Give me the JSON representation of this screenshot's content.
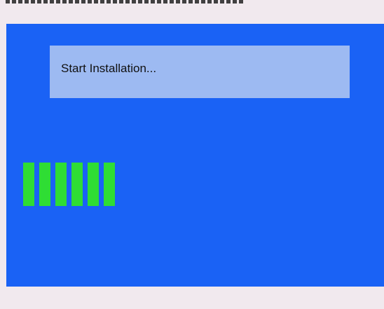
{
  "installer": {
    "message": "Start Installation...",
    "progress": {
      "filled_segments": 6
    }
  },
  "colors": {
    "panel": "#1a62f5",
    "message_box": "#9dbaf2",
    "progress_segment": "#2fdd34",
    "border": "#f1e9ee"
  }
}
